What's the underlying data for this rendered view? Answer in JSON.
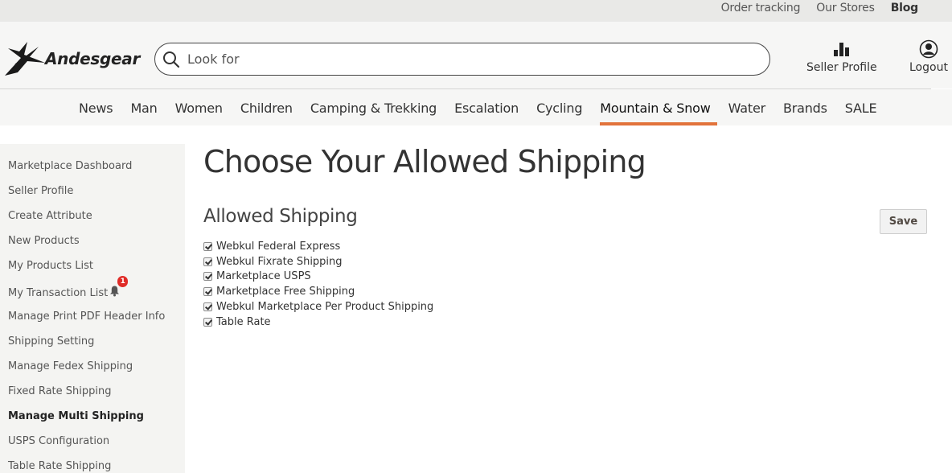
{
  "top_links": {
    "order_tracking": "Order tracking",
    "our_stores": "Our Stores",
    "blog": "Blog"
  },
  "header": {
    "logo_text": "Andesgear",
    "logo_icon": "bird-logo-icon",
    "search_placeholder": "Look for",
    "seller_profile": "Seller Profile",
    "seller_icon": "bar-chart-icon",
    "logout": "Logout",
    "logout_icon": "user-icon"
  },
  "nav": {
    "items": [
      "News",
      "Man",
      "Women",
      "Children",
      "Camping & Trekking",
      "Escalation",
      "Cycling",
      "Mountain & Snow",
      "Water",
      "Brands",
      "SALE"
    ],
    "active": "Mountain & Snow",
    "active_color": "#e2733b"
  },
  "sidebar": {
    "items": [
      "Marketplace Dashboard",
      "Seller Profile",
      "Create Attribute",
      "New Products",
      "My Products List",
      "My Transaction List",
      "Manage Print PDF Header Info",
      "Shipping Setting",
      "Manage Fedex Shipping",
      "Fixed Rate Shipping",
      "Manage Multi Shipping",
      "USPS Configuration",
      "Table Rate Shipping"
    ],
    "current": "Manage Multi Shipping",
    "notification_count": "1",
    "badge_color": "#e02b27"
  },
  "main": {
    "page_title": "Choose Your Allowed Shipping",
    "section_title": "Allowed Shipping",
    "save_label": "Save",
    "options": [
      {
        "label": "Webkul Federal Express",
        "checked": true
      },
      {
        "label": "Webkul Fixrate Shipping",
        "checked": true
      },
      {
        "label": "Marketplace USPS",
        "checked": true
      },
      {
        "label": "Marketplace Free Shipping",
        "checked": true
      },
      {
        "label": "Webkul Marketplace Per Product Shipping",
        "checked": true
      },
      {
        "label": "Table Rate",
        "checked": true
      }
    ]
  }
}
